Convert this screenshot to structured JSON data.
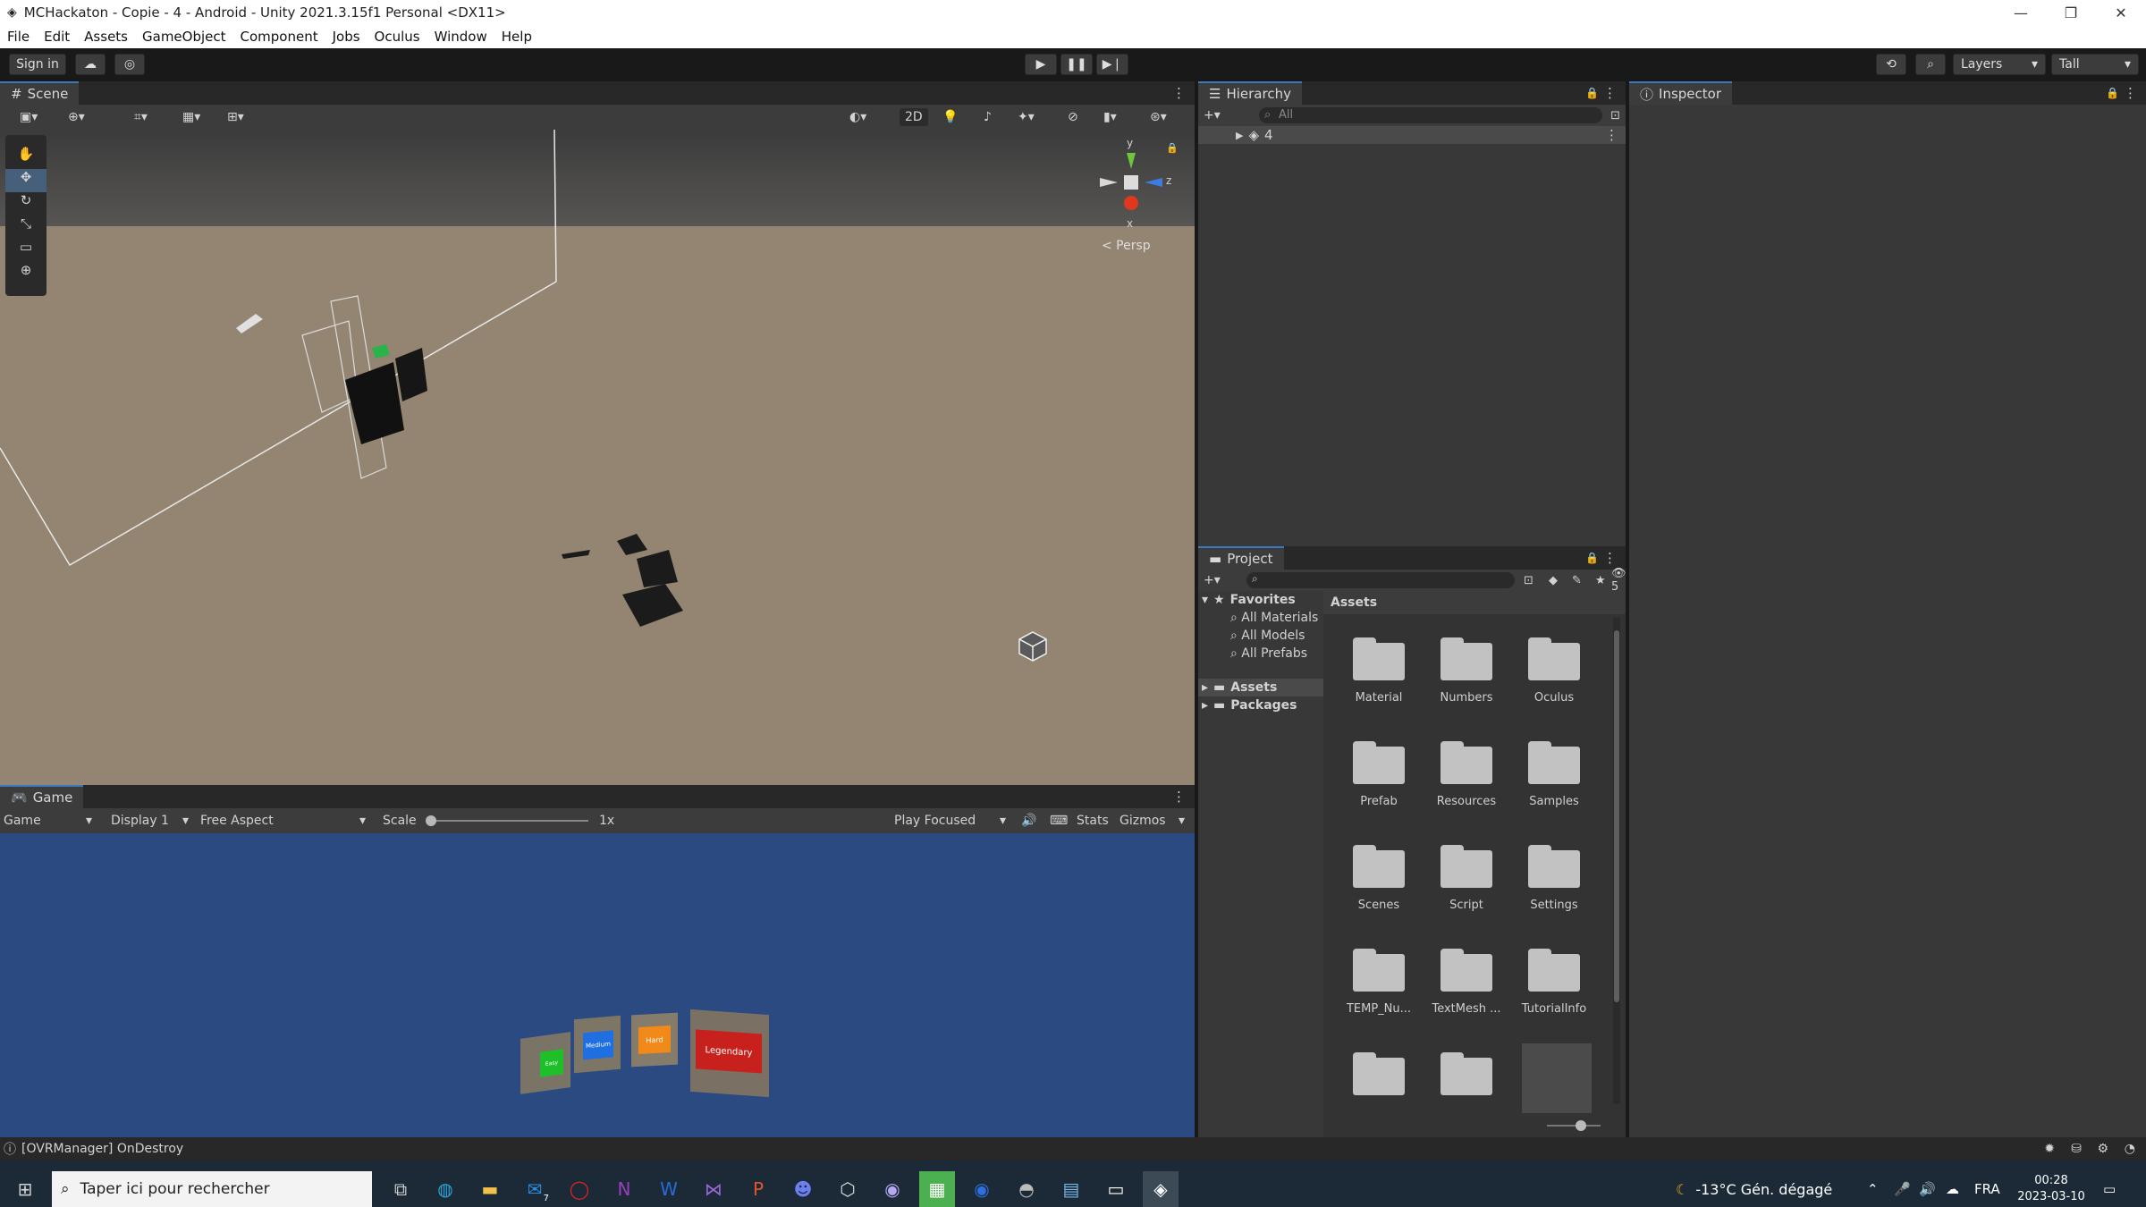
{
  "window": {
    "title": "MCHackaton - Copie - 4 - Android - Unity 2021.3.15f1 Personal <DX11>",
    "controls": [
      "—",
      "❐",
      "✕"
    ]
  },
  "menu": [
    "File",
    "Edit",
    "Assets",
    "GameObject",
    "Component",
    "Jobs",
    "Oculus",
    "Window",
    "Help"
  ],
  "toolbar": {
    "sign_in": "Sign in",
    "layers": "Layers",
    "layout": "Tall"
  },
  "scene": {
    "tab": "Scene",
    "toggle_2d": "2D",
    "persp": "< Persp",
    "gizmo_y": "y",
    "gizmo_z": "z",
    "gizmo_x": "x"
  },
  "game": {
    "tab": "Game",
    "mode": "Game",
    "display": "Display 1",
    "aspect": "Free Aspect",
    "scale_label": "Scale",
    "scale_value": "1x",
    "play_focus": "Play Focused",
    "stats": "Stats",
    "gizmos": "Gizmos",
    "cubes": [
      "Easy",
      "Medium",
      "Hard",
      "Legendary"
    ]
  },
  "hierarchy": {
    "tab": "Hierarchy",
    "search_placeholder": "All",
    "root_item": "4"
  },
  "inspector": {
    "tab": "Inspector"
  },
  "project": {
    "tab": "Project",
    "hidden_count": "5",
    "favorites": "Favorites",
    "favorite_items": [
      "All Materials",
      "All Models",
      "All Prefabs"
    ],
    "tree": [
      "Assets",
      "Packages"
    ],
    "breadcrumb": "Assets",
    "folders": [
      "Material",
      "Numbers",
      "Oculus",
      "Prefab",
      "Resources",
      "Samples",
      "Scenes",
      "Script",
      "Settings",
      "TEMP_Nu...",
      "TextMesh ...",
      "TutorialInfo",
      "",
      ""
    ]
  },
  "status": {
    "message": "[OVRManager] OnDestroy"
  },
  "taskbar": {
    "search_placeholder": "Taper ici pour rechercher",
    "weather": "-13°C  Gén. dégagé",
    "lang": "FRA",
    "time": "00:28",
    "date": "2023-03-10",
    "mail_badge": "7"
  },
  "colors": {
    "accent": "#3a79bb",
    "scene_ground": "#938572",
    "game_sky": "#2b4a82"
  }
}
